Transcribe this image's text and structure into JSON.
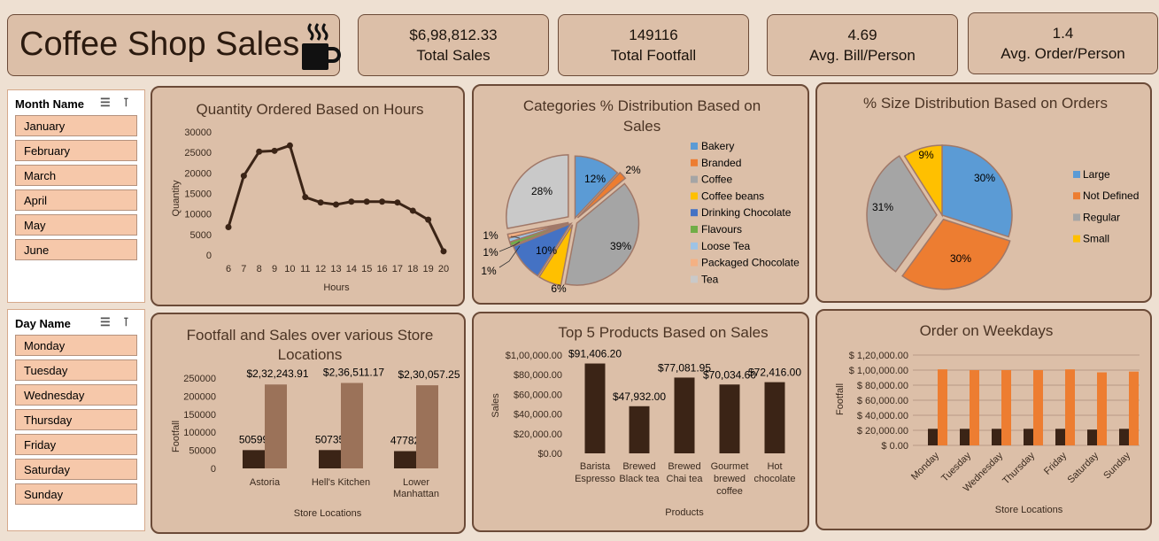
{
  "header": {
    "title": "Coffee Shop Sales",
    "icon": "coffee-cup-icon"
  },
  "kpis": [
    {
      "value": "$6,98,812.33",
      "label": "Total Sales"
    },
    {
      "value": "149116",
      "label": "Total Footfall"
    },
    {
      "value": "4.69",
      "label": "Avg. Bill/Person"
    },
    {
      "value": "1.4",
      "label": "Avg. Order/Person"
    }
  ],
  "month_slicer": {
    "title": "Month Name",
    "items": [
      "January",
      "February",
      "March",
      "April",
      "May",
      "June"
    ]
  },
  "day_slicer": {
    "title": "Day Name",
    "items": [
      "Monday",
      "Tuesday",
      "Wednesday",
      "Thursday",
      "Friday",
      "Saturday",
      "Sunday"
    ]
  },
  "chart_data": [
    {
      "type": "line",
      "title": "Quantity Ordered Based on Hours",
      "xlabel": "Hours",
      "ylabel": "Quantity",
      "ylim": [
        0,
        30000
      ],
      "yticks": [
        "30000",
        "25000",
        "20000",
        "15000",
        "10000",
        "5000",
        "0"
      ],
      "x": [
        6,
        7,
        8,
        9,
        10,
        11,
        12,
        13,
        14,
        15,
        16,
        17,
        18,
        19,
        20
      ],
      "values": [
        6800,
        19300,
        25200,
        25400,
        26700,
        14100,
        12800,
        12300,
        13000,
        13000,
        13000,
        12800,
        10800,
        8600,
        900
      ],
      "color": "#3b2416"
    },
    {
      "type": "pie",
      "title": "Categories % Distribution Based on Sales",
      "labels": [
        "Bakery",
        "Branded",
        "Coffee",
        "Coffee beans",
        "Drinking Chocolate",
        "Flavours",
        "Loose Tea",
        "Packaged Chocolate",
        "Tea"
      ],
      "values": [
        12,
        2,
        39,
        6,
        10,
        1,
        1,
        1,
        28
      ],
      "value_labels": [
        "12%",
        "2%",
        "39%",
        "6%",
        "10%",
        "1%",
        "1%",
        "1%",
        "28%"
      ],
      "colors": [
        "#5b9bd5",
        "#ed7d31",
        "#a5a5a5",
        "#ffc000",
        "#4472c4",
        "#70ad47",
        "#9dc3e6",
        "#f4b183",
        "#c9c9c9"
      ],
      "legend": "right"
    },
    {
      "type": "pie",
      "title": "% Size Distribution Based on Orders",
      "labels": [
        "Large",
        "Not Defined",
        "Regular",
        "Small"
      ],
      "values": [
        30,
        30,
        31,
        9
      ],
      "value_labels": [
        "30%",
        "30%",
        "31%",
        "9%"
      ],
      "colors": [
        "#5b9bd5",
        "#ed7d31",
        "#a5a5a5",
        "#ffc000"
      ],
      "legend": "right"
    },
    {
      "type": "bar",
      "title": "Footfall and Sales over various Store Locations",
      "xlabel": "Store Locations",
      "ylabel": "Footfall",
      "ylim": [
        0,
        250000
      ],
      "yticks": [
        "250000",
        "200000",
        "150000",
        "100000",
        "50000",
        "0"
      ],
      "categories": [
        "Astoria",
        "Hell's Kitchen",
        "Lower Manhattan"
      ],
      "series": [
        {
          "values": [
            50599,
            50735,
            47782
          ],
          "labels": [
            "50599",
            "50735",
            "47782"
          ],
          "color": "#3b2416"
        },
        {
          "values": [
            232243.91,
            236511.17,
            230057.25
          ],
          "labels": [
            "$2,32,243.91",
            "$2,36,511.17",
            "$2,30,057.25"
          ],
          "color": "#9b7259"
        }
      ]
    },
    {
      "type": "bar",
      "title": "Top 5 Products Based on Sales",
      "xlabel": "Products",
      "ylabel": "Sales",
      "ylim": [
        0,
        100000
      ],
      "yticks": [
        "$1,00,000.00",
        "$80,000.00",
        "$60,000.00",
        "$40,000.00",
        "$20,000.00",
        "$0.00"
      ],
      "categories": [
        "Barista Espresso",
        "Brewed Black tea",
        "Brewed Chai tea",
        "Gourmet brewed coffee",
        "Hot chocolate"
      ],
      "values": [
        91406.2,
        47932.0,
        77081.95,
        70034.6,
        72416.0
      ],
      "labels": [
        "$91,406.20",
        "$47,932.00",
        "$77,081.95",
        "$70,034.60",
        "$72,416.00"
      ],
      "color": "#3b2416"
    },
    {
      "type": "bar",
      "title": "Order on Weekdays",
      "xlabel": "Store Locations",
      "ylabel": "Footfall",
      "ylim": [
        0,
        120000
      ],
      "yticks": [
        "$ 1,20,000.00",
        "$ 1,00,000.00",
        "$ 80,000.00",
        "$ 60,000.00",
        "$ 40,000.00",
        "$ 20,000.00",
        "$ 0.00"
      ],
      "categories": [
        "Monday",
        "Tuesday",
        "Wednesday",
        "Thursday",
        "Friday",
        "Saturday",
        "Sunday"
      ],
      "series": [
        {
          "values": [
            22000,
            22000,
            22000,
            22000,
            22000,
            21000,
            22000
          ],
          "color": "#3b2416"
        },
        {
          "values": [
            101000,
            100000,
            100000,
            100000,
            101000,
            97000,
            98000
          ],
          "color": "#ed7d31"
        }
      ]
    }
  ]
}
